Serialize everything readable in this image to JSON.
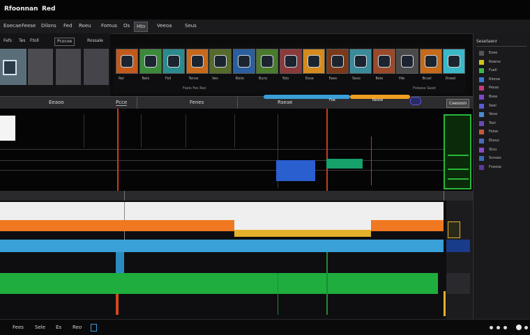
{
  "title_bar": {
    "app_title": "Rfoonnan",
    "item": "Red"
  },
  "menu": [
    {
      "label": "Eoecae",
      "boxed": false
    },
    {
      "label": "Feese",
      "boxed": false
    },
    {
      "label": "Dilons",
      "boxed": false
    },
    {
      "label": "Fed",
      "boxed": false
    },
    {
      "label": "Roeu",
      "boxed": false
    },
    {
      "label": "Fomus",
      "boxed": false
    },
    {
      "label": "Os",
      "boxed": false
    },
    {
      "label": "Hto",
      "boxed": true
    },
    {
      "label": "Veeoa",
      "boxed": false
    },
    {
      "label": "Seus",
      "boxed": false
    }
  ],
  "preview_tabs": [
    {
      "label": "Fefs",
      "boxed": false
    },
    {
      "label": "Tes",
      "boxed": false
    },
    {
      "label": "Ftoll",
      "boxed": false
    },
    {
      "label": "Pcocoe",
      "boxed": true
    },
    {
      "label": "Rossale",
      "boxed": false
    }
  ],
  "clips": [
    {
      "label": "Rel",
      "color": "#c25a1e"
    },
    {
      "label": "Belo",
      "color": "#3a8a3a"
    },
    {
      "label": "Fell",
      "color": "#2a8b8f"
    },
    {
      "label": "Tenos",
      "color": "#c7691d"
    },
    {
      "label": "Ves",
      "color": "#566a2a"
    },
    {
      "label": "Rlelo",
      "color": "#2a5e9e"
    },
    {
      "label": "Bunc",
      "color": "#4a7a2b"
    },
    {
      "label": "Tolo",
      "color": "#8a3a3a"
    },
    {
      "label": "Eose",
      "color": "#d48a1c"
    },
    {
      "label": "Faeo",
      "color": "#7a3a1a"
    },
    {
      "label": "Seso",
      "color": "#3a8a9a"
    },
    {
      "label": "Bole",
      "color": "#9a4a2a"
    },
    {
      "label": "Hle",
      "color": "#4a4a4a"
    },
    {
      "label": "Bruel",
      "color": "#c46a1a"
    },
    {
      "label": "Rneel",
      "color": "#3ab8c8"
    }
  ],
  "clip_subtext": [
    "Feels Fes Reo",
    "Foleess Saod"
  ],
  "right_panel": {
    "header": "Sesetaenr",
    "items": [
      {
        "label": "Eoee",
        "color": "#555555"
      },
      {
        "label": "Rowne",
        "color": "#d4c21a"
      },
      {
        "label": "Fuell",
        "color": "#3ab84a"
      },
      {
        "label": "Rloroa",
        "color": "#3a7ad4"
      },
      {
        "label": "Pesso",
        "color": "#c43a7a"
      },
      {
        "label": "Bsoe",
        "color": "#7a4ac8"
      },
      {
        "label": "Seel",
        "color": "#5a5ad4"
      },
      {
        "label": "Veve",
        "color": "#4a8ad4"
      },
      {
        "label": "Tool",
        "color": "#6a4ab8"
      },
      {
        "label": "Feloe",
        "color": "#c45a3a"
      },
      {
        "label": "Ekeus",
        "color": "#4a6ab8"
      },
      {
        "label": "Stou",
        "color": "#8a4ac8"
      },
      {
        "label": "Ssnoes",
        "color": "#3a6ab8"
      },
      {
        "label": "Fneose",
        "color": "#5a3a9a"
      }
    ]
  },
  "section_header": {
    "labels": [
      "Eeaoo",
      "Pcce",
      "Fenes",
      "Rseae"
    ],
    "pills": [
      "Foe",
      "Resne"
    ],
    "right_button": "Ceesosn"
  },
  "bottom_bar": [
    "Fees",
    "Sele",
    "Es",
    "Reo"
  ],
  "colors": {
    "orange": "#f07820",
    "blue": "#3aa0d8",
    "green": "#1fae3e",
    "yellow": "#e4b22a",
    "clip_blue": "#2a5fd0",
    "clip_teal": "#16a06a",
    "red_marker": "#d03a20"
  }
}
